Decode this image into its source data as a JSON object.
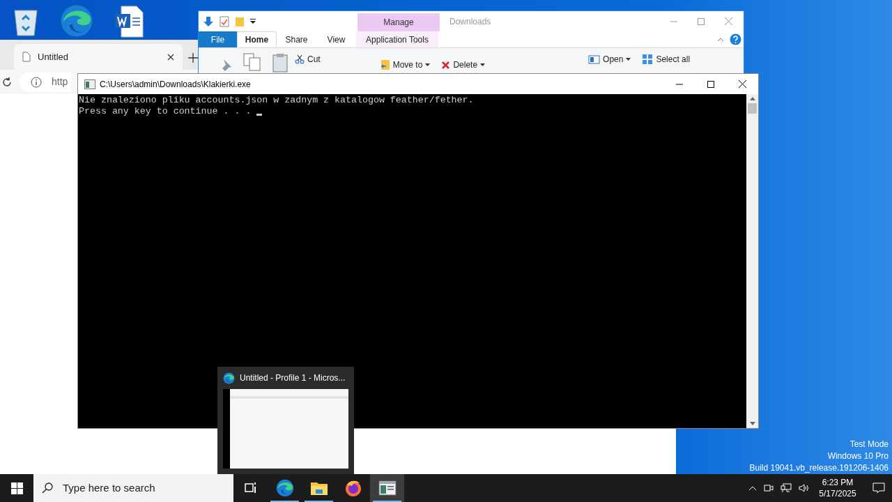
{
  "browser": {
    "tab": {
      "title": "Untitled"
    },
    "address": "http"
  },
  "explorer": {
    "title": "Downloads",
    "context_tab": "Manage",
    "tabs": [
      {
        "label": "File",
        "kind": "file",
        "selected": false
      },
      {
        "label": "Home",
        "kind": "tab",
        "selected": true
      },
      {
        "label": "Share",
        "kind": "tab",
        "selected": false
      },
      {
        "label": "View",
        "kind": "tab",
        "selected": false
      },
      {
        "label": "Application Tools",
        "kind": "tab",
        "selected": false
      }
    ],
    "ribbon": [
      {
        "label": "Cut",
        "kind": "scissors"
      },
      {
        "label": "Move to",
        "kind": "move"
      },
      {
        "label": "Delete",
        "kind": "delete"
      },
      {
        "label": "Open",
        "kind": "open"
      },
      {
        "label": "Select all",
        "kind": "select"
      }
    ]
  },
  "console": {
    "title": "C:\\Users\\admin\\Downloads\\Klakierki.exe",
    "lines": [
      "Nie znaleziono pliku accounts.json w zadnym z katalogow feather/fether.",
      "Press any key to continue . . ."
    ]
  },
  "preview": {
    "title": "Untitled - Profile 1 - Micros..."
  },
  "desktop_text": [
    "Test Mode",
    "Windows 10 Pro",
    "Build 19041.vb_release.191206-1406"
  ],
  "taskbar": {
    "search_placeholder": "Type here to search",
    "apps": [
      {
        "kind": "taskview",
        "running": false,
        "selected": false
      },
      {
        "kind": "edge",
        "running": true,
        "selected": false
      },
      {
        "kind": "explorer",
        "running": true,
        "selected": false
      },
      {
        "kind": "firefox",
        "running": false,
        "selected": false
      },
      {
        "kind": "console",
        "running": true,
        "selected": true
      }
    ],
    "time": "6:23 PM",
    "date": "5/17/2025"
  }
}
